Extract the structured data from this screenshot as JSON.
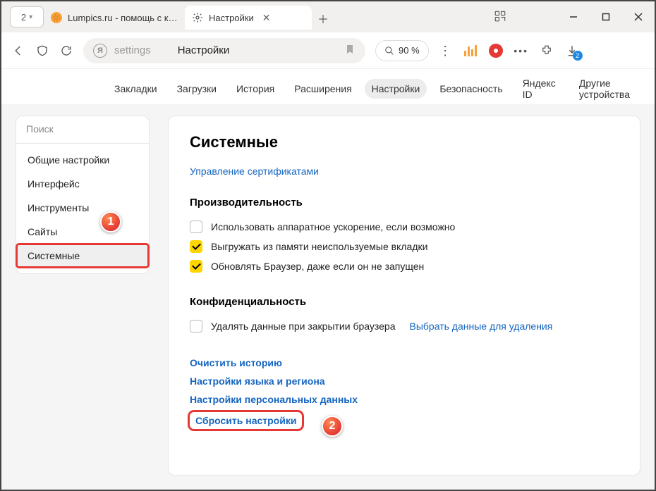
{
  "window": {
    "tab_count": "2",
    "tabs": [
      {
        "title": "Lumpics.ru - помощь с ком"
      },
      {
        "title": "Настройки"
      }
    ],
    "controls": {
      "minimize": "—",
      "maximize": "□",
      "close": "✕"
    }
  },
  "addressbar": {
    "path": "settings",
    "page_title": "Настройки",
    "zoom": "90 %",
    "download_badge": "2"
  },
  "catnav": {
    "items": [
      "Закладки",
      "Загрузки",
      "История",
      "Расширения",
      "Настройки",
      "Безопасность",
      "Яндекс ID",
      "Другие устройства"
    ],
    "active_index": 4
  },
  "sidebar": {
    "search_placeholder": "Поиск",
    "items": [
      "Общие настройки",
      "Интерфейс",
      "Инструменты",
      "Сайты",
      "Системные"
    ],
    "active_index": 4
  },
  "content": {
    "heading": "Системные",
    "cert_link": "Управление сертификатами",
    "perf": {
      "title": "Производительность",
      "opts": [
        {
          "label": "Использовать аппаратное ускорение, если возможно",
          "checked": false
        },
        {
          "label": "Выгружать из памяти неиспользуемые вкладки",
          "checked": true
        },
        {
          "label": "Обновлять Браузер, даже если он не запущен",
          "checked": true
        }
      ]
    },
    "privacy": {
      "title": "Конфиденциальность",
      "opt_label": "Удалять данные при закрытии браузера",
      "opt_checked": false,
      "choose_link": "Выбрать данные для удаления"
    },
    "links": [
      "Очистить историю",
      "Настройки языка и региона",
      "Настройки персональных данных",
      "Сбросить настройки"
    ]
  },
  "annotations": {
    "one": "1",
    "two": "2"
  }
}
